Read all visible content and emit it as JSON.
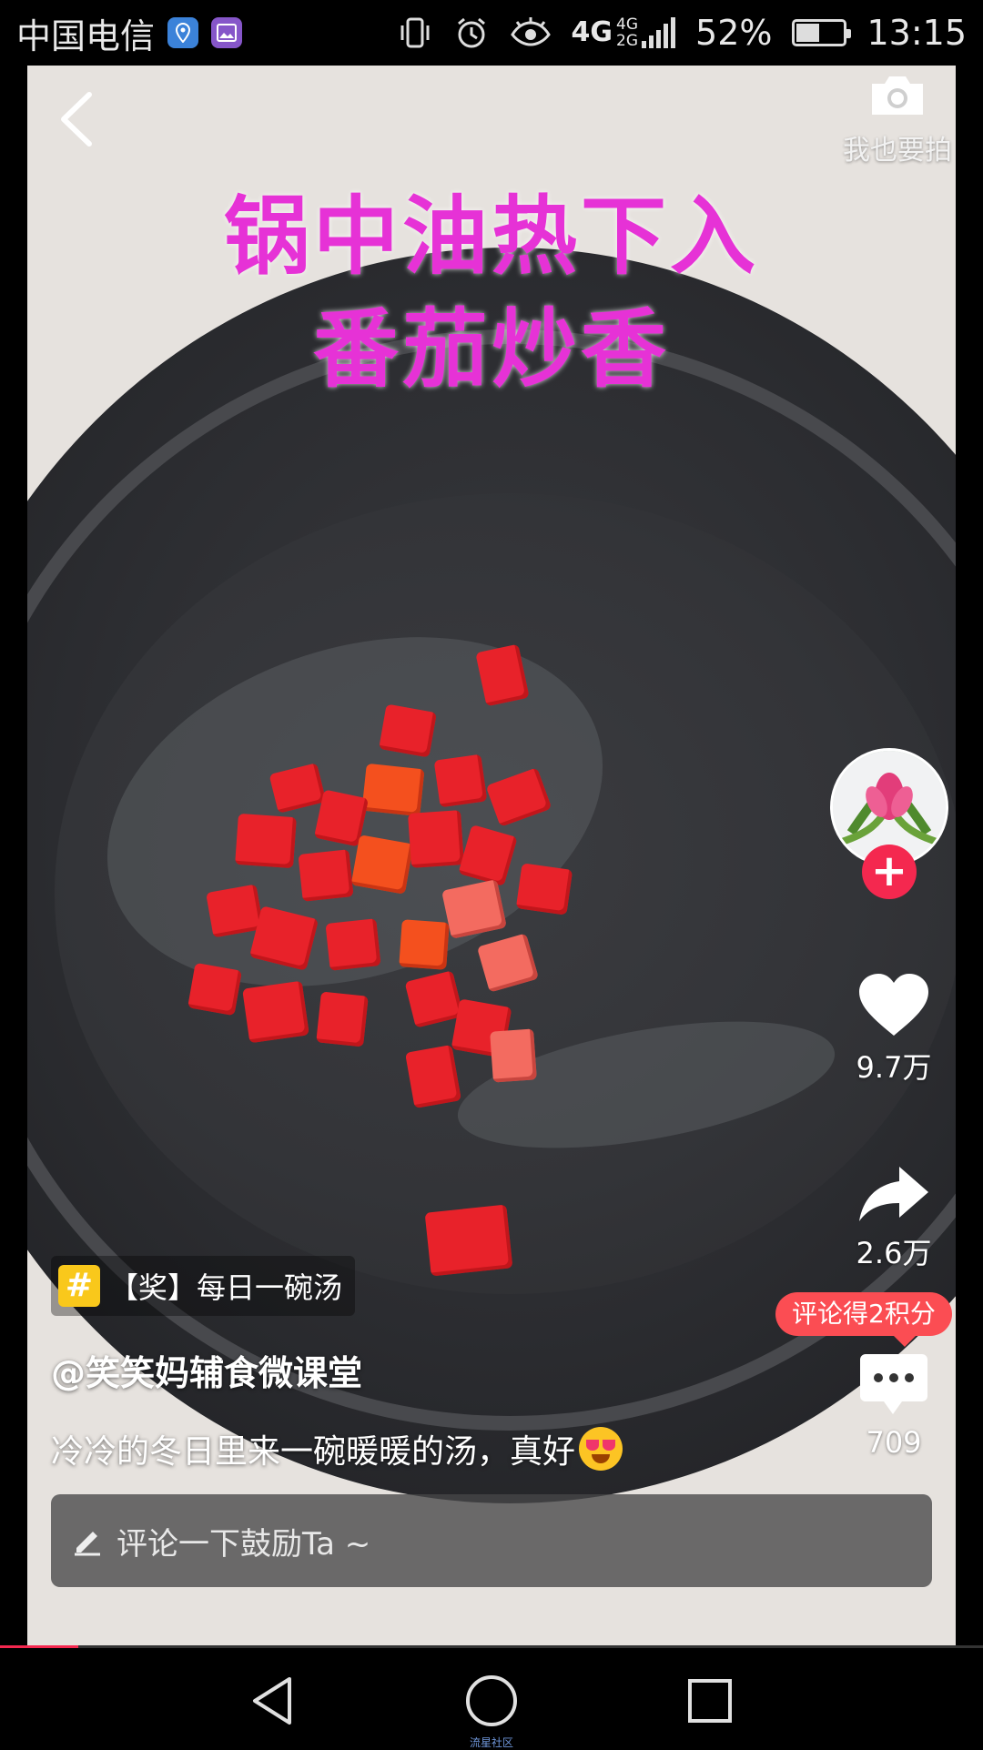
{
  "status_bar": {
    "carrier": "中国电信",
    "network_main": "4G",
    "network_secondary_top": "4G",
    "network_secondary_bottom": "2G",
    "battery_level": 0.52,
    "battery_text": "52%",
    "time": "13:15",
    "icons": [
      "location-app-icon",
      "gallery-app-icon",
      "vibrate-icon",
      "alarm-icon",
      "eye-icon",
      "signal-icon",
      "battery-icon"
    ]
  },
  "video": {
    "caption_line1": "锅中油热下入",
    "caption_line2": "番茄炒香"
  },
  "header": {
    "back_icon": "chevron-left-icon",
    "camera_label": "我也要拍"
  },
  "rail": {
    "likes": "9.7万",
    "shares": "2.6万",
    "comments": "709",
    "comment_tip": "评论得2积分"
  },
  "info": {
    "topic": "【奖】每日一碗汤",
    "author": "@笑笑妈辅食微课堂",
    "description": "冷冷的冬日里来一碗暖暖的汤，真好"
  },
  "comment_box": {
    "placeholder": "评论一下鼓励Ta ~"
  },
  "playback": {
    "progress": 0.08
  },
  "nav_bar": {
    "caption": "流星社区"
  },
  "colors": {
    "accent": "#f4284f",
    "caption_magenta": "#e632d6",
    "tip_red": "#fb4d53",
    "topic_yellow": "#f9c81b"
  }
}
